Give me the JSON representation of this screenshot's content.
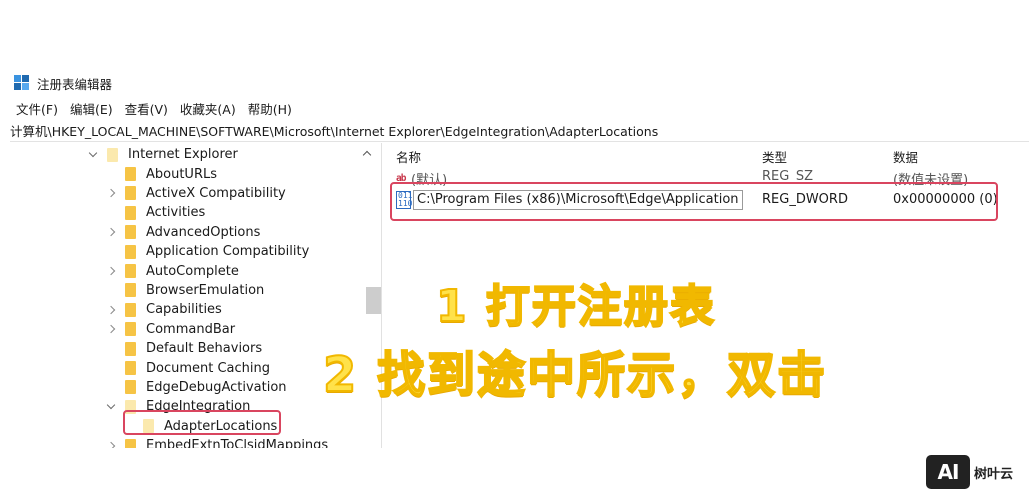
{
  "window": {
    "title": "注册表编辑器"
  },
  "menu": [
    {
      "label": "文件(F)"
    },
    {
      "label": "编辑(E)"
    },
    {
      "label": "查看(V)"
    },
    {
      "label": "收藏夹(A)"
    },
    {
      "label": "帮助(H)"
    }
  ],
  "address": "计算机\\HKEY_LOCAL_MACHINE\\SOFTWARE\\Microsoft\\Internet Explorer\\EdgeIntegration\\AdapterLocations",
  "tree": [
    {
      "label": "Internet Explorer",
      "chevron": "down"
    },
    {
      "label": "AboutURLs",
      "chevron": "none"
    },
    {
      "label": "ActiveX Compatibility",
      "chevron": "right"
    },
    {
      "label": "Activities",
      "chevron": "none"
    },
    {
      "label": "AdvancedOptions",
      "chevron": "right"
    },
    {
      "label": "Application Compatibility",
      "chevron": "none"
    },
    {
      "label": "AutoComplete",
      "chevron": "right"
    },
    {
      "label": "BrowserEmulation",
      "chevron": "none"
    },
    {
      "label": "Capabilities",
      "chevron": "right"
    },
    {
      "label": "CommandBar",
      "chevron": "right"
    },
    {
      "label": "Default Behaviors",
      "chevron": "none"
    },
    {
      "label": "Document Caching",
      "chevron": "none"
    },
    {
      "label": "EdgeDebugActivation",
      "chevron": "none"
    },
    {
      "label": "EdgeIntegration",
      "chevron": "down"
    },
    {
      "label": "AdapterLocations",
      "chevron": "none"
    },
    {
      "label": "EmbedExtnToClsidMappings",
      "chevron": "right"
    }
  ],
  "list": {
    "headers": {
      "name": "名称",
      "type": "类型",
      "data": "数据"
    },
    "rows": [
      {
        "icon": "ab",
        "name": "(默认)",
        "type": "REG_SZ",
        "data": "(数值未设置)"
      },
      {
        "icon": "bin",
        "name": "C:\\Program Files (x86)\\Microsoft\\Edge\\Application",
        "type": "REG_DWORD",
        "data": "0x00000000 (0)"
      }
    ]
  },
  "overlay": {
    "line1": "1 打开注册表",
    "line2": "2 找到途中所示，双击"
  },
  "logo": {
    "mark": "AI",
    "text": "树叶云"
  },
  "colors": {
    "highlight": "#d9455f",
    "overlay_text": "#ffe24a",
    "folder": "#f6c445"
  }
}
